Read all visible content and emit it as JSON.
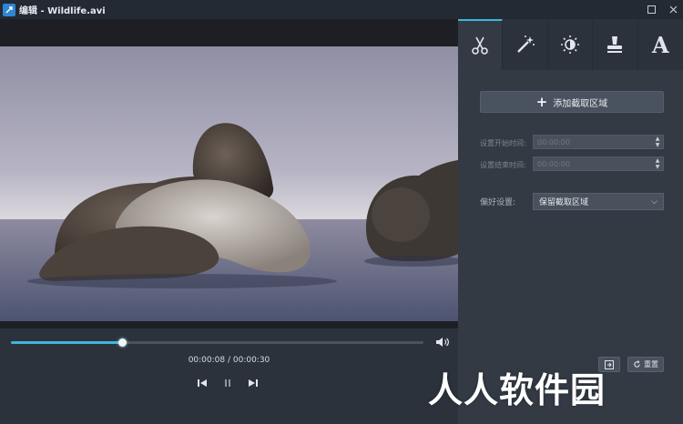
{
  "window": {
    "title": "编辑 - Wildlife.avi"
  },
  "player": {
    "progress": 0.27,
    "timecode": "00:00:08 / 00:00:30"
  },
  "tabs": [
    {
      "name": "cut",
      "icon": "scissors-icon",
      "active": true
    },
    {
      "name": "effects",
      "icon": "magic-wand-icon",
      "active": false
    },
    {
      "name": "adjust",
      "icon": "brightness-icon",
      "active": false
    },
    {
      "name": "watermark",
      "icon": "stamp-icon",
      "active": false
    },
    {
      "name": "text",
      "icon": "text-icon",
      "label": "A",
      "active": false
    }
  ],
  "trim": {
    "add_label": "添加截取区域",
    "start_label": "设置开始时间:",
    "start_value": "00:00:00",
    "end_label": "设置结束时间:",
    "end_value": "00:00:00",
    "pref_label": "偏好设置:",
    "pref_value": "保留截取区域",
    "reset_label": "重置"
  },
  "overlay": {
    "watermark_text": "人人软件园"
  },
  "colors": {
    "accent": "#3fb6d9",
    "panel": "#333a44",
    "titlebar": "#232a33"
  }
}
